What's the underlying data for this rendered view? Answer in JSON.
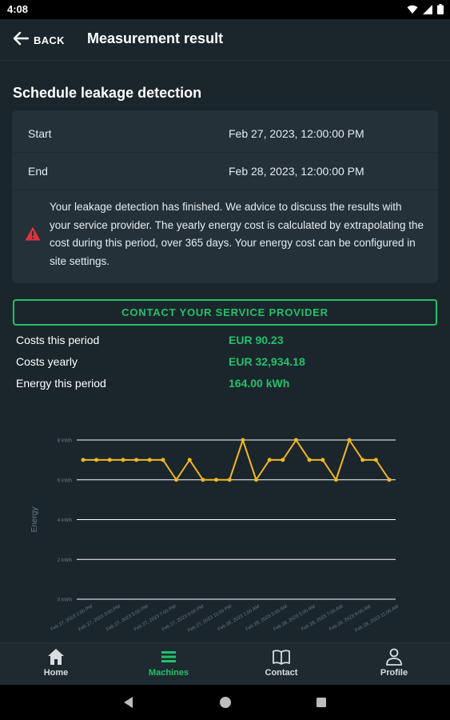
{
  "status_bar": {
    "time": "4:08",
    "icons": [
      "wifi-icon",
      "signal-icon",
      "battery-icon"
    ]
  },
  "app_bar": {
    "back_label": "BACK",
    "title": "Measurement result"
  },
  "section": {
    "title": "Schedule leakage detection"
  },
  "schedule": {
    "start_label": "Start",
    "start_value": "Feb 27, 2023, 12:00:00 PM",
    "end_label": "End",
    "end_value": "Feb 28, 2023, 12:00:00 PM",
    "warning_text": "Your leakage detection has finished. We advice to discuss the results with your service provider. The yearly energy cost is calculated by extrapolating the cost during this period, over 365 days. Your energy cost can be configured in site settings."
  },
  "contact_button": {
    "label": "CONTACT YOUR SERVICE PROVIDER"
  },
  "stats": [
    {
      "label": "Costs this period",
      "value": "EUR 90.23"
    },
    {
      "label": "Costs yearly",
      "value": "EUR 32,934.18"
    },
    {
      "label": "Energy this period",
      "value": "164.00 kWh"
    }
  ],
  "chart_data": {
    "type": "line",
    "ylabel": "Energy",
    "ylim": [
      0,
      8
    ],
    "y_ticks": [
      "0 kWh",
      "2 kWh",
      "4 kWh",
      "6 kWh",
      "8 kWh"
    ],
    "x_ticks": [
      "Feb 27, 2023 1:00 PM",
      "Feb 27, 2023 3:00 PM",
      "Feb 27, 2023 5:00 PM",
      "Feb 27, 2023 7:00 PM",
      "Feb 27, 2023 9:00 PM",
      "Feb 27, 2023 11:00 PM",
      "Feb 28, 2023 1:00 AM",
      "Feb 28, 2023 3:00 AM",
      "Feb 28, 2023 5:00 AM",
      "Feb 28, 2023 7:00 AM",
      "Feb 28, 2023 9:00 AM",
      "Feb 28, 2023 11:00 AM"
    ],
    "series": [
      {
        "values": [
          7,
          7,
          7,
          7,
          7,
          7,
          7,
          6,
          7,
          6,
          6,
          6,
          8,
          6,
          7,
          7,
          8,
          7,
          7,
          6,
          8,
          7,
          7,
          6
        ]
      }
    ],
    "grid": true,
    "colors": {
      "line": "#f2b821",
      "grid": "#ffffff",
      "text": "#6b7980"
    }
  },
  "bottom_nav": [
    {
      "label": "Home",
      "icon": "home-icon",
      "active": false
    },
    {
      "label": "Machines",
      "icon": "list-icon",
      "active": true
    },
    {
      "label": "Contact",
      "icon": "book-icon",
      "active": false
    },
    {
      "label": "Profile",
      "icon": "person-icon",
      "active": false
    }
  ],
  "system_nav": {
    "icons": [
      "back-triangle-icon",
      "home-circle-icon",
      "recents-square-icon"
    ]
  },
  "colors": {
    "background": "#1a262c",
    "card": "#243138",
    "accent": "#23c16b",
    "warning": "#e0323a"
  }
}
